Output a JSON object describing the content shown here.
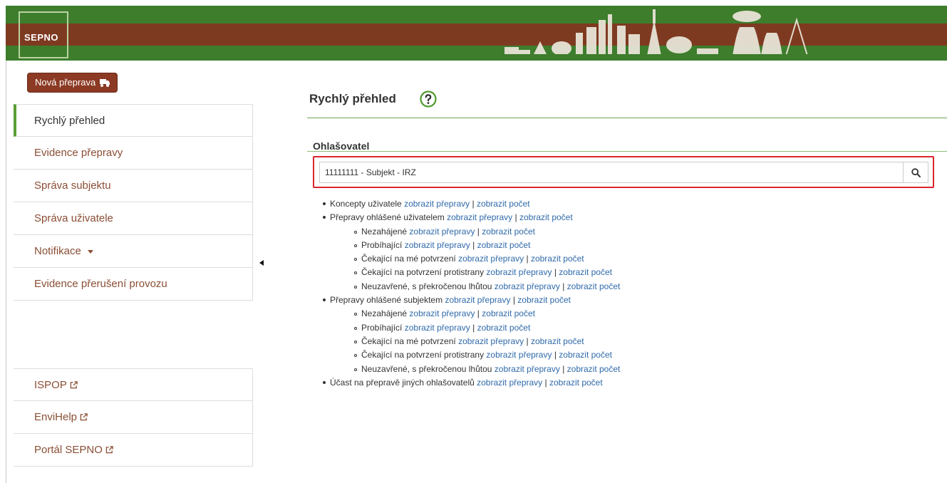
{
  "header": {
    "logo_text": "SEPNO"
  },
  "sidebar": {
    "new_button_label": "Nová přeprava",
    "items": [
      {
        "label": "Rychlý přehled"
      },
      {
        "label": "Evidence přepravy"
      },
      {
        "label": "Správa subjektu"
      },
      {
        "label": "Správa uživatele"
      },
      {
        "label": "Notifikace"
      },
      {
        "label": "Evidence přerušení provozu"
      }
    ],
    "external_links": [
      {
        "label": "ISPOP"
      },
      {
        "label": "EnviHelp"
      },
      {
        "label": "Portál SEPNO"
      }
    ]
  },
  "main": {
    "title": "Rychlý přehled",
    "section_title": "Ohlašovatel",
    "search_value": "11111111 - Subjekt - IRZ",
    "link_show": "zobrazit přepravy",
    "link_count": "zobrazit počet",
    "link_separator": "|",
    "rows": [
      "Koncepty uživatele",
      "Přepravy ohlášené uživatelem",
      "Nezahájené",
      "Probíhající",
      "Čekající na mé potvrzení",
      "Čekající na potvrzení protistrany",
      "Neuzavřené, s překročenou lhůtou",
      "Přepravy ohlášené subjektem",
      "Nezahájené",
      "Probíhající",
      "Čekající na mé potvrzení",
      "Čekající na potvrzení protistrany",
      "Neuzavřené, s překročenou lhůtou",
      "Účast na přepravě jiných ohlašovatelů"
    ]
  },
  "colors": {
    "header_green": "#3d7d2c",
    "header_brown": "#7e3a21",
    "button_brown": "#8c3a24",
    "link_blue": "#2f6aaa",
    "highlight_red": "#d9262b",
    "active_green": "#5a9e35"
  }
}
